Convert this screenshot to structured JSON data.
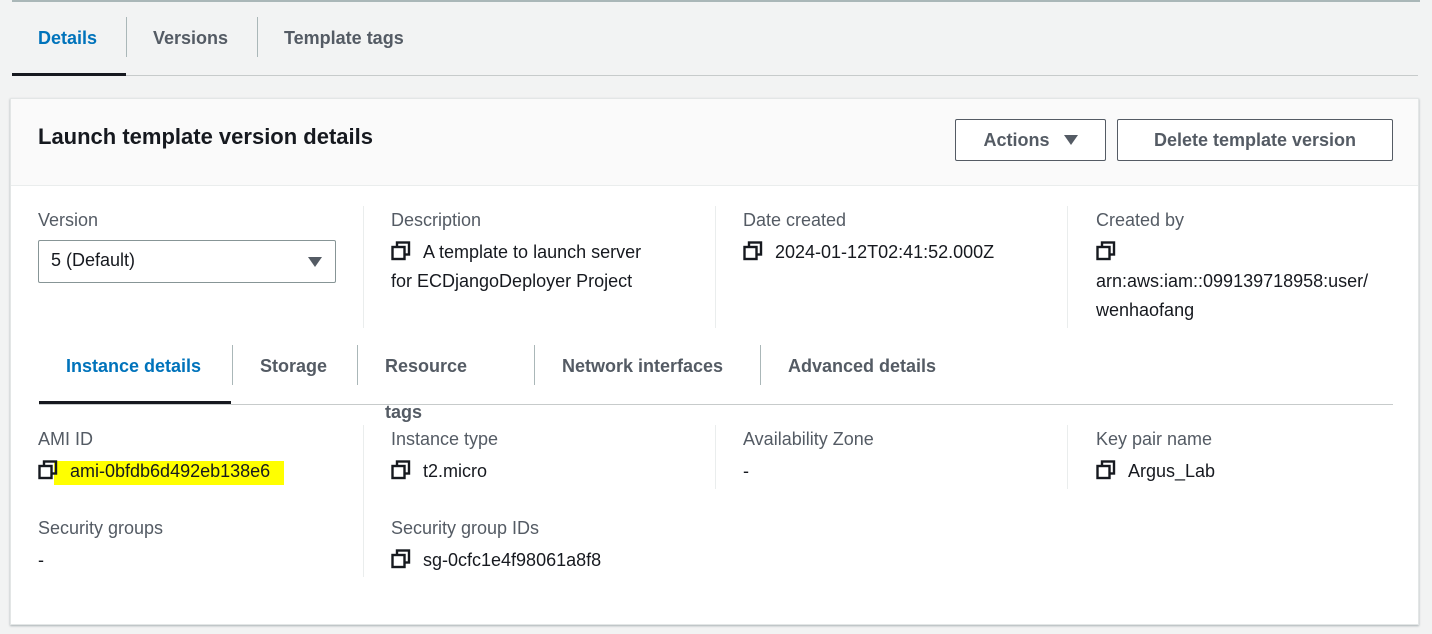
{
  "top_tabs": [
    {
      "label": "Details",
      "active": true
    },
    {
      "label": "Versions",
      "active": false
    },
    {
      "label": "Template tags",
      "active": false
    }
  ],
  "panel": {
    "title": "Launch template version details",
    "actions_label": "Actions",
    "delete_label": "Delete template version"
  },
  "summary": {
    "version_label": "Version",
    "version_value": "5 (Default)",
    "description_label": "Description",
    "description_line1": "A template to launch server",
    "description_line2": "for ECDjangoDeployer Project",
    "date_label": "Date created",
    "date_value": "2024-01-12T02:41:52.000Z",
    "created_by_label": "Created by",
    "created_by_line1": "arn:aws:iam::099139718958:user/",
    "created_by_line2": "wenhaofang"
  },
  "inner_tabs": [
    {
      "label": "Instance details",
      "active": true
    },
    {
      "label": "Storage",
      "active": false
    },
    {
      "label": "Resource tags",
      "active": false
    },
    {
      "label": "Network interfaces",
      "active": false
    },
    {
      "label": "Advanced details",
      "active": false
    }
  ],
  "instance": {
    "ami_label": "AMI ID",
    "ami_value": "ami-0bfdb6d492eb138e6",
    "type_label": "Instance type",
    "type_value": "t2.micro",
    "az_label": "Availability Zone",
    "az_value": "-",
    "keypair_label": "Key pair name",
    "keypair_value": "Argus_Lab",
    "sg_label": "Security groups",
    "sg_value": "-",
    "sgid_label": "Security group IDs",
    "sgid_value": "sg-0cfc1e4f98061a8f8"
  },
  "colors": {
    "accent": "#0073bb",
    "highlight": "#ffff00"
  },
  "icons": {
    "copy": "copy-icon",
    "dropdown": "caret-down-icon"
  }
}
